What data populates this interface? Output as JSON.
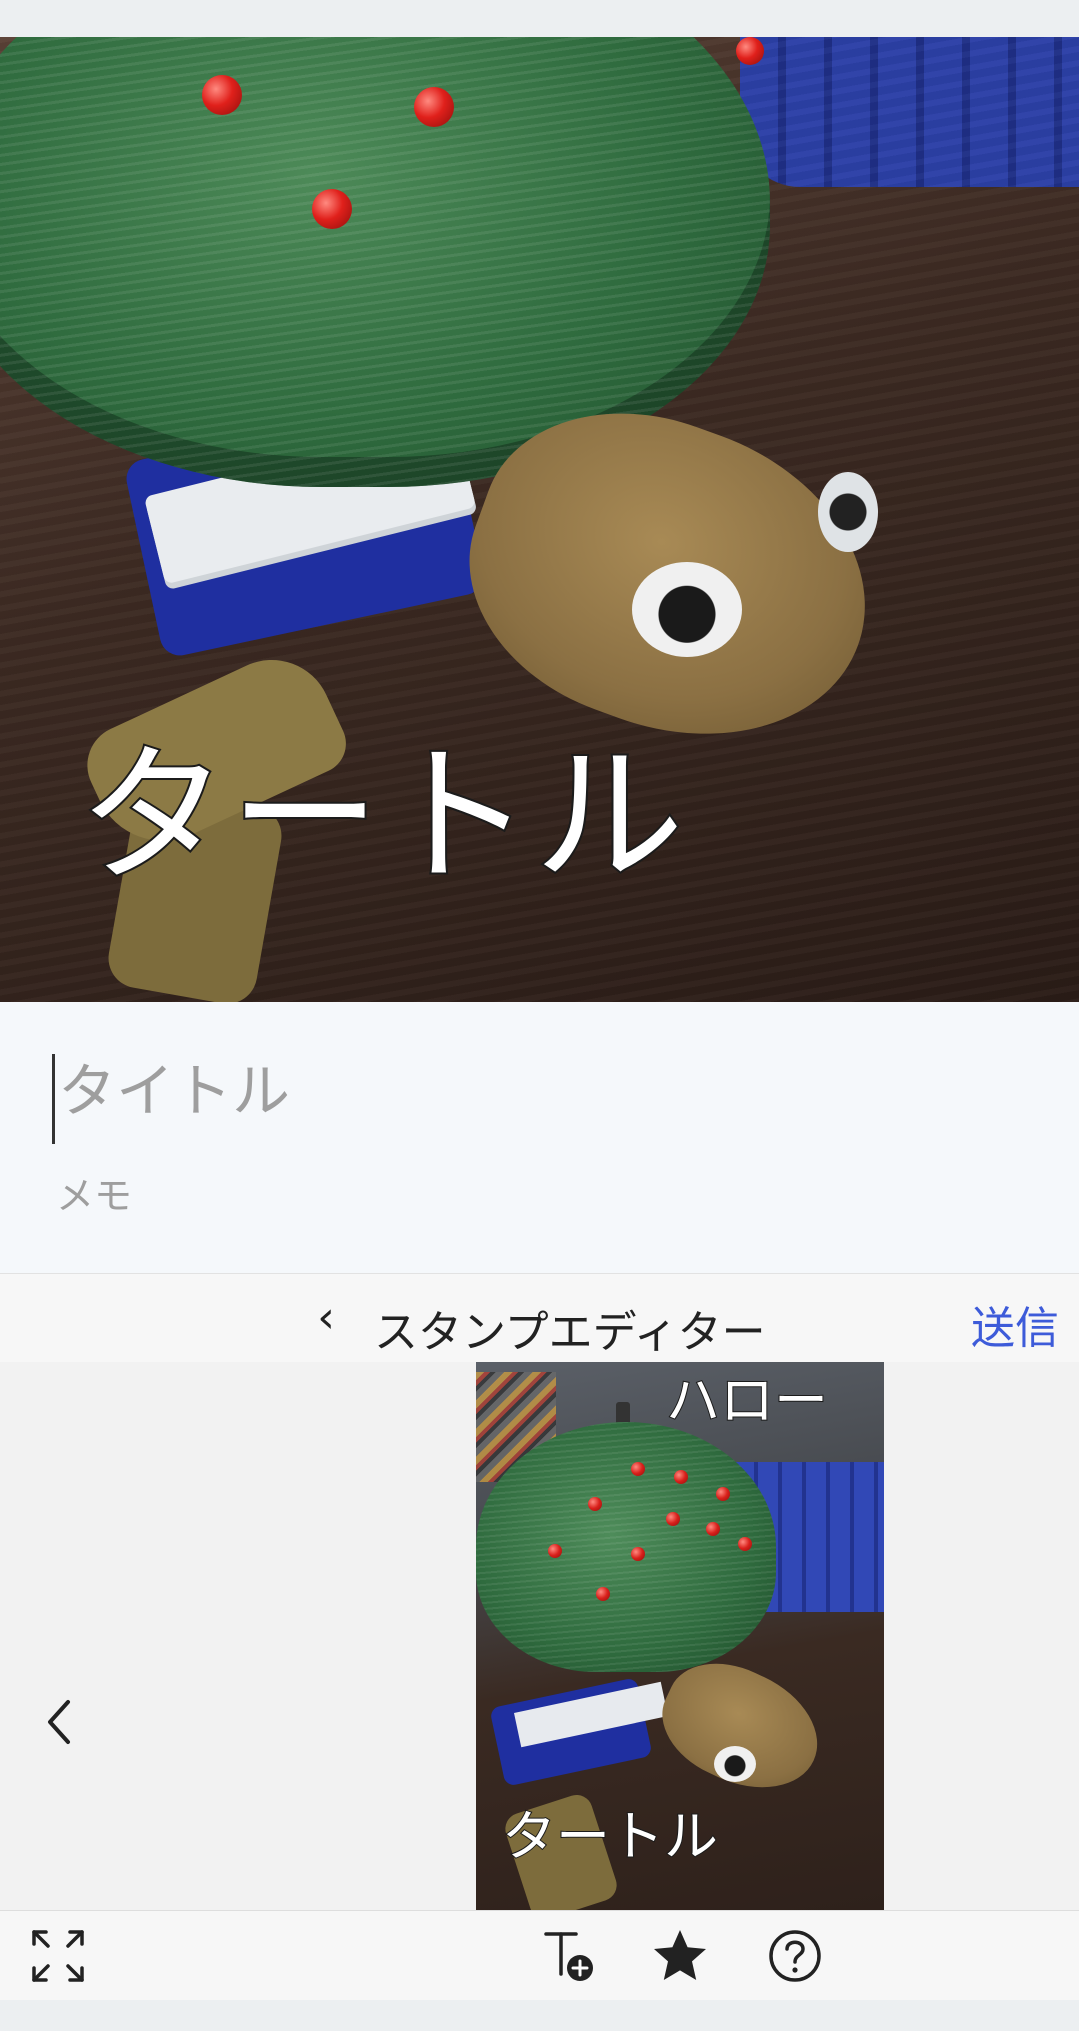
{
  "hero": {
    "caption": "タートル"
  },
  "form": {
    "title_placeholder": "タイトル",
    "memo_placeholder": "メモ"
  },
  "stamp_editor": {
    "back_label": "‹",
    "title": "スタンプエディター",
    "send_label": "送信"
  },
  "preview": {
    "stamp_top_text": "ハロー",
    "stamp_bottom_text": "タートル"
  },
  "toolbar": {
    "icons": [
      "expand-icon",
      "add-text-icon",
      "star-icon",
      "help-icon"
    ]
  },
  "colors": {
    "accent": "#3d5bd9",
    "form_background": "#f5f8fb",
    "toolbar_background": "#f7f7f7",
    "canvas_background": "#f2f2f2"
  }
}
